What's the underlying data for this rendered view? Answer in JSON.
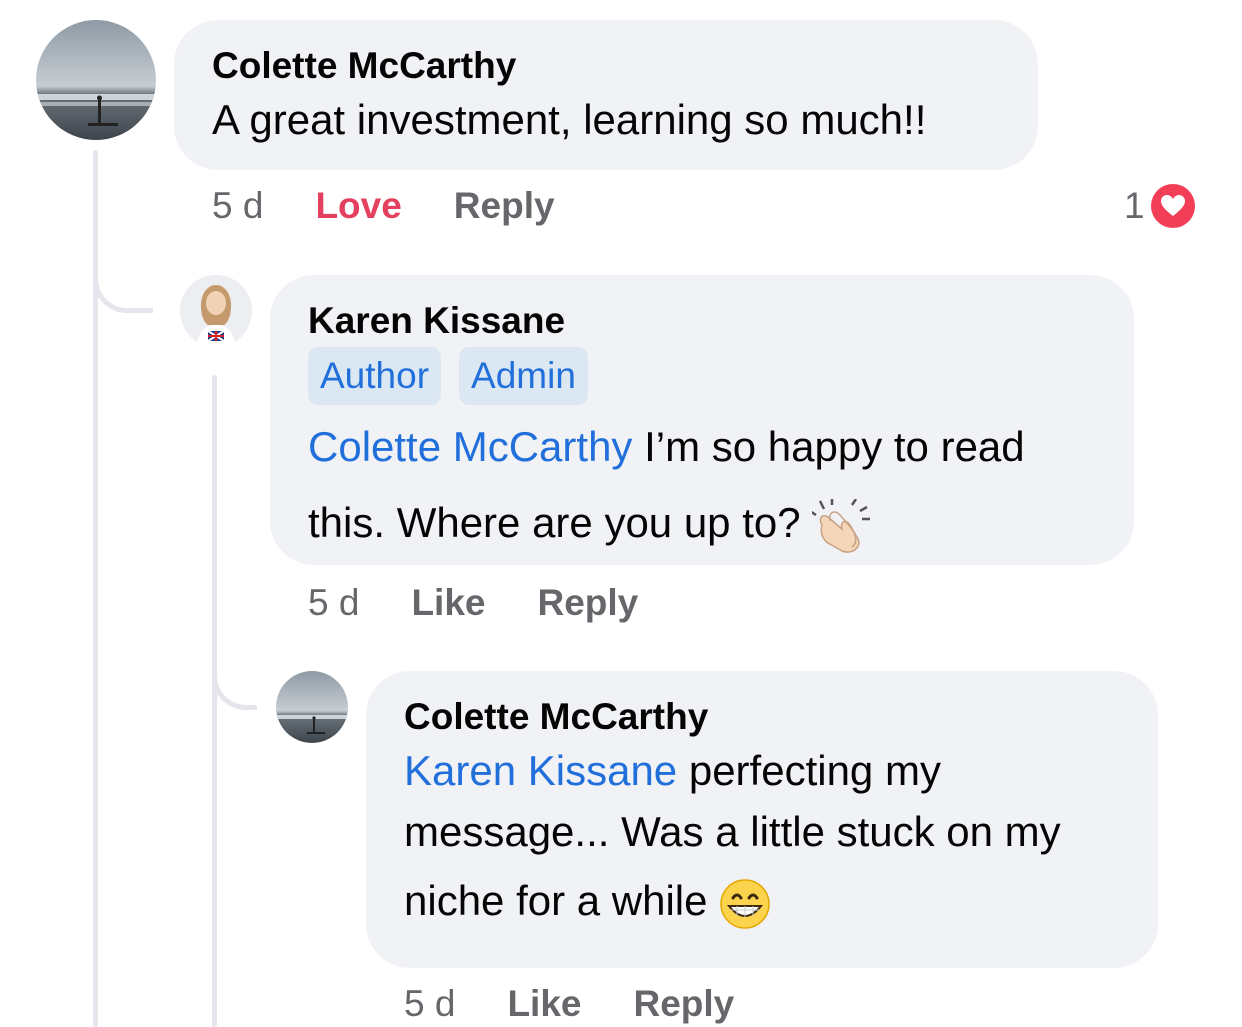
{
  "comments": [
    {
      "author": "Colette McCarthy",
      "text": "A great investment, learning so much!!",
      "time": "5 d",
      "actions": {
        "love": "Love",
        "reply": "Reply"
      },
      "reaction_count": "1",
      "reaction_type": "heart-icon"
    },
    {
      "author": "Karen Kissane",
      "badges": [
        "Author",
        "Admin"
      ],
      "mention": "Colette McCarthy",
      "text_line1": " I’m so happy to read",
      "text_line2": "this. Where are you up to?",
      "emoji": "clapping-hands-emoji",
      "time": "5 d",
      "actions": {
        "like": "Like",
        "reply": "Reply"
      }
    },
    {
      "author": "Colette McCarthy",
      "mention": "Karen Kissane",
      "text_line1": " perfecting my",
      "text_line2": "message... Was a little stuck on my",
      "text_line3": "niche for a while",
      "emoji": "grinning-face-emoji",
      "time": "5 d",
      "actions": {
        "like": "Like",
        "reply": "Reply"
      }
    }
  ],
  "colors": {
    "bubble": "#f0f2f5",
    "mention": "#216fdb",
    "love": "#e4405f",
    "meta": "#65676b",
    "thread": "#e4e6eb"
  }
}
